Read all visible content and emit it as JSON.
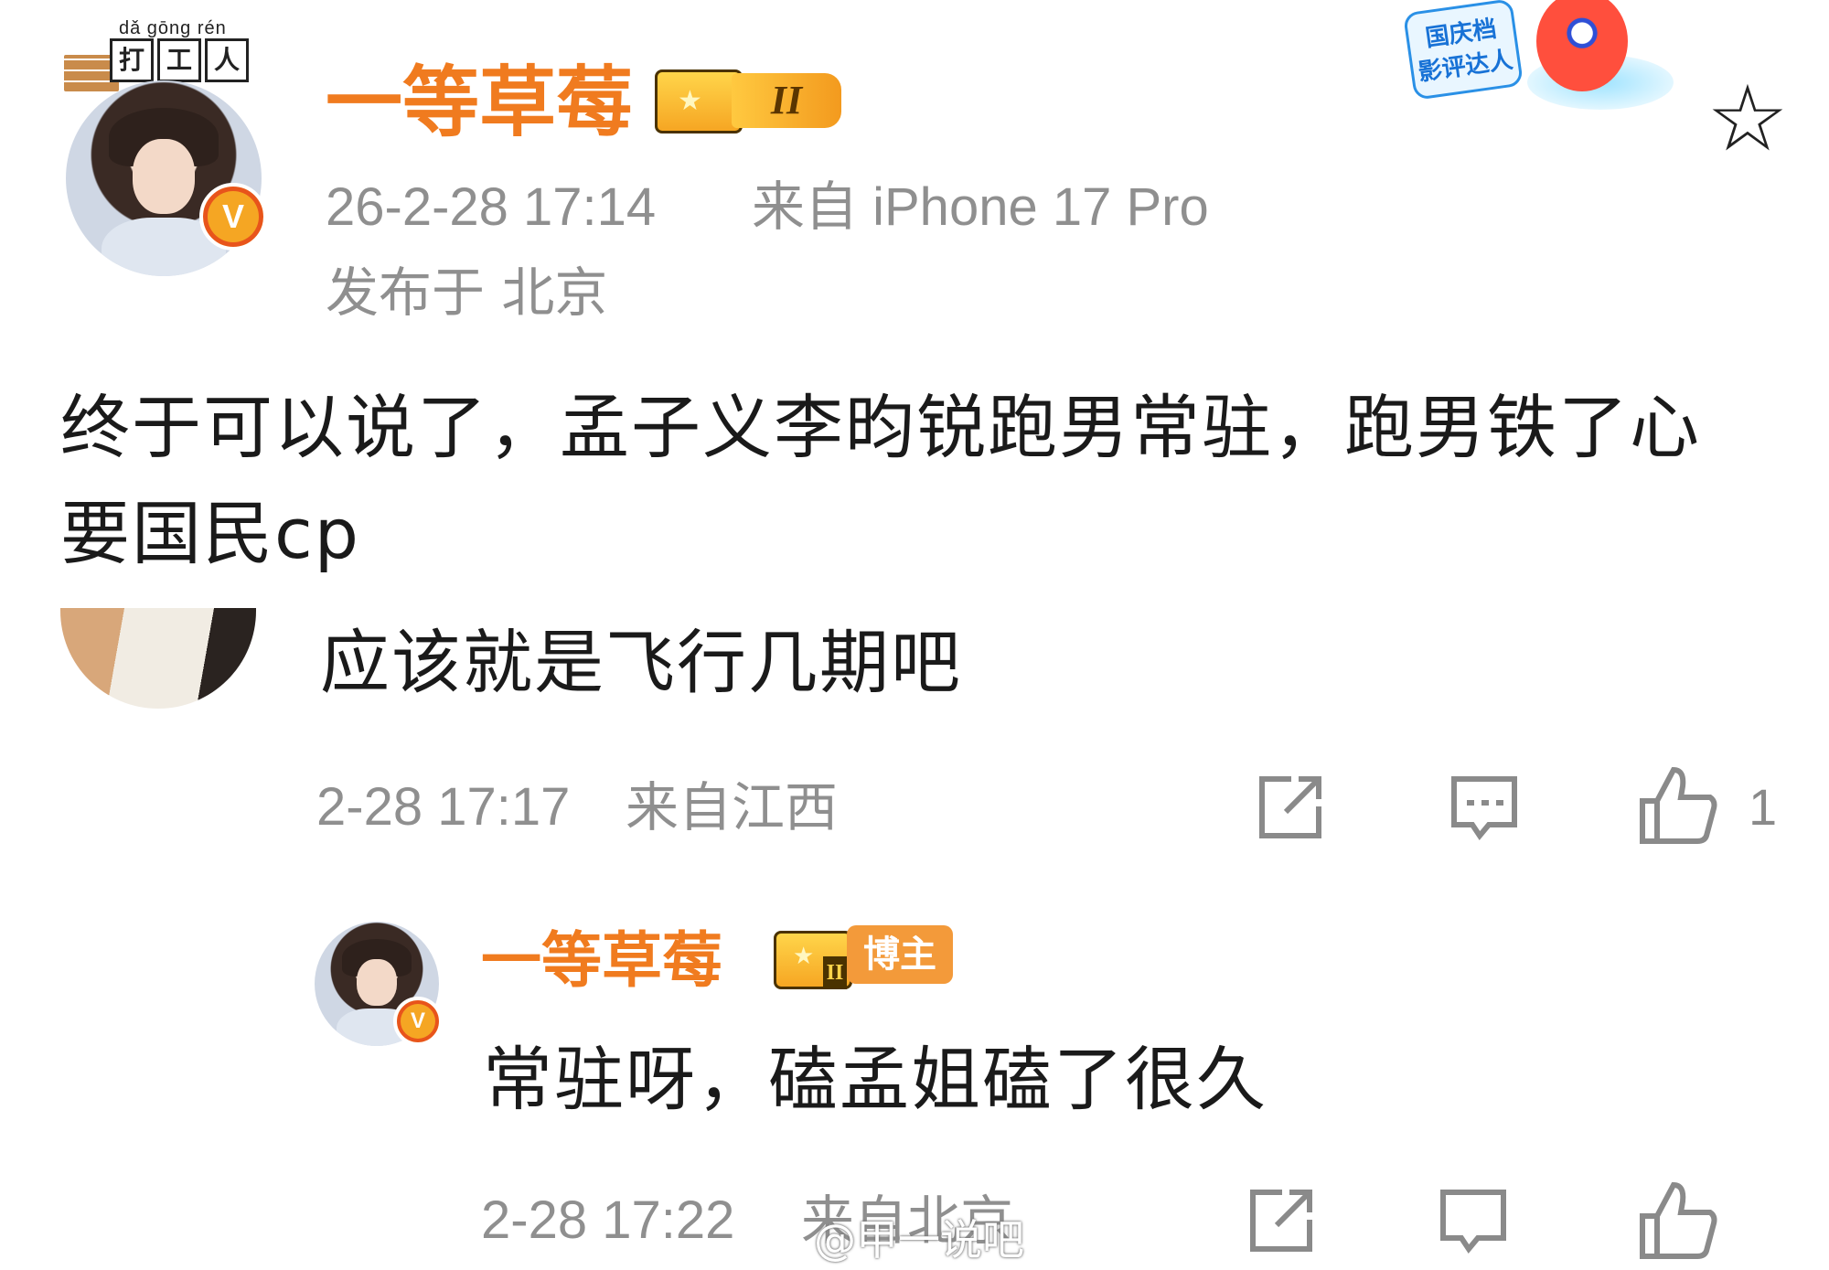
{
  "post": {
    "pendant": {
      "pinyin": "dǎ gōng rén",
      "chars": [
        "打",
        "工",
        "人"
      ]
    },
    "username": "一等草莓",
    "level_badge": "II",
    "timestamp": "26-2-28 17:14",
    "source": "来自 iPhone 17 Pro",
    "location": "发布于 北京",
    "event_badge": "国庆档\n影评达人",
    "text": "终于可以说了，孟子义李昀锐跑男常驻，跑男铁了心要国民cp"
  },
  "comments": [
    {
      "text": "应该就是飞行几期吧",
      "time": "2-28 17:17",
      "location": "来自江西",
      "like_count": "1",
      "icons": [
        "share-icon",
        "comment-icon",
        "like-icon"
      ]
    }
  ],
  "reply": {
    "username": "一等草莓",
    "crown_level": "II",
    "role_tag": "博主",
    "text": "常驻呀，磕孟姐磕了很久",
    "time": "2-28 17:22",
    "location": "来自北京",
    "icons": [
      "share-icon",
      "comment-icon",
      "like-icon"
    ]
  },
  "watermark": "@甲一说吧",
  "colors": {
    "username": "#f07b1f",
    "meta": "#8f8f8f",
    "text": "#1a1a1a"
  }
}
